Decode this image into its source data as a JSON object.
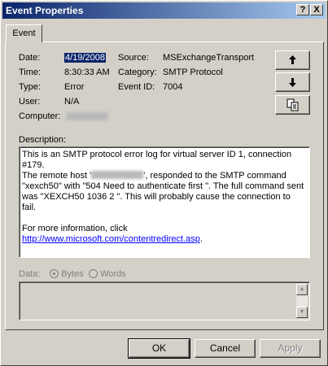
{
  "window": {
    "title": "Event Properties",
    "help_label": "?",
    "close_label": "X"
  },
  "tabs": [
    {
      "label": "Event"
    }
  ],
  "event": {
    "date_label": "Date:",
    "date_value": "4/19/2008",
    "time_label": "Time:",
    "time_value": "8:30:33 AM",
    "type_label": "Type:",
    "type_value": "Error",
    "user_label": "User:",
    "user_value": "N/A",
    "computer_label": "Computer:",
    "source_label": "Source:",
    "source_value": "MSExchangeTransport",
    "category_label": "Category:",
    "category_value": "SMTP Protocol",
    "event_id_label": "Event ID:",
    "event_id_value": "7004"
  },
  "nav": {
    "up_icon": "arrow-up-icon",
    "down_icon": "arrow-down-icon",
    "copy_icon": "copy-icon"
  },
  "description": {
    "label": "Description:",
    "line1": "This is an SMTP protocol error log for virtual server ID 1, connection #179.",
    "line2a": "The remote host '",
    "line2b": "', responded to the SMTP command",
    "line3": "\"xexch50\" with \"504 Need to authenticate first  \". The full command sent",
    "line4": "was \"XEXCH50 1036 2  \".  This will probably cause the connection to fail.",
    "more_info": "For more information, click ",
    "link": "http://www.microsoft.com/contentredirect.asp",
    "link_end": "."
  },
  "data_section": {
    "label": "Data:",
    "bytes_label": "Bytes",
    "words_label": "Words",
    "selected": "Bytes"
  },
  "buttons": {
    "ok": "OK",
    "cancel": "Cancel",
    "apply": "Apply"
  }
}
